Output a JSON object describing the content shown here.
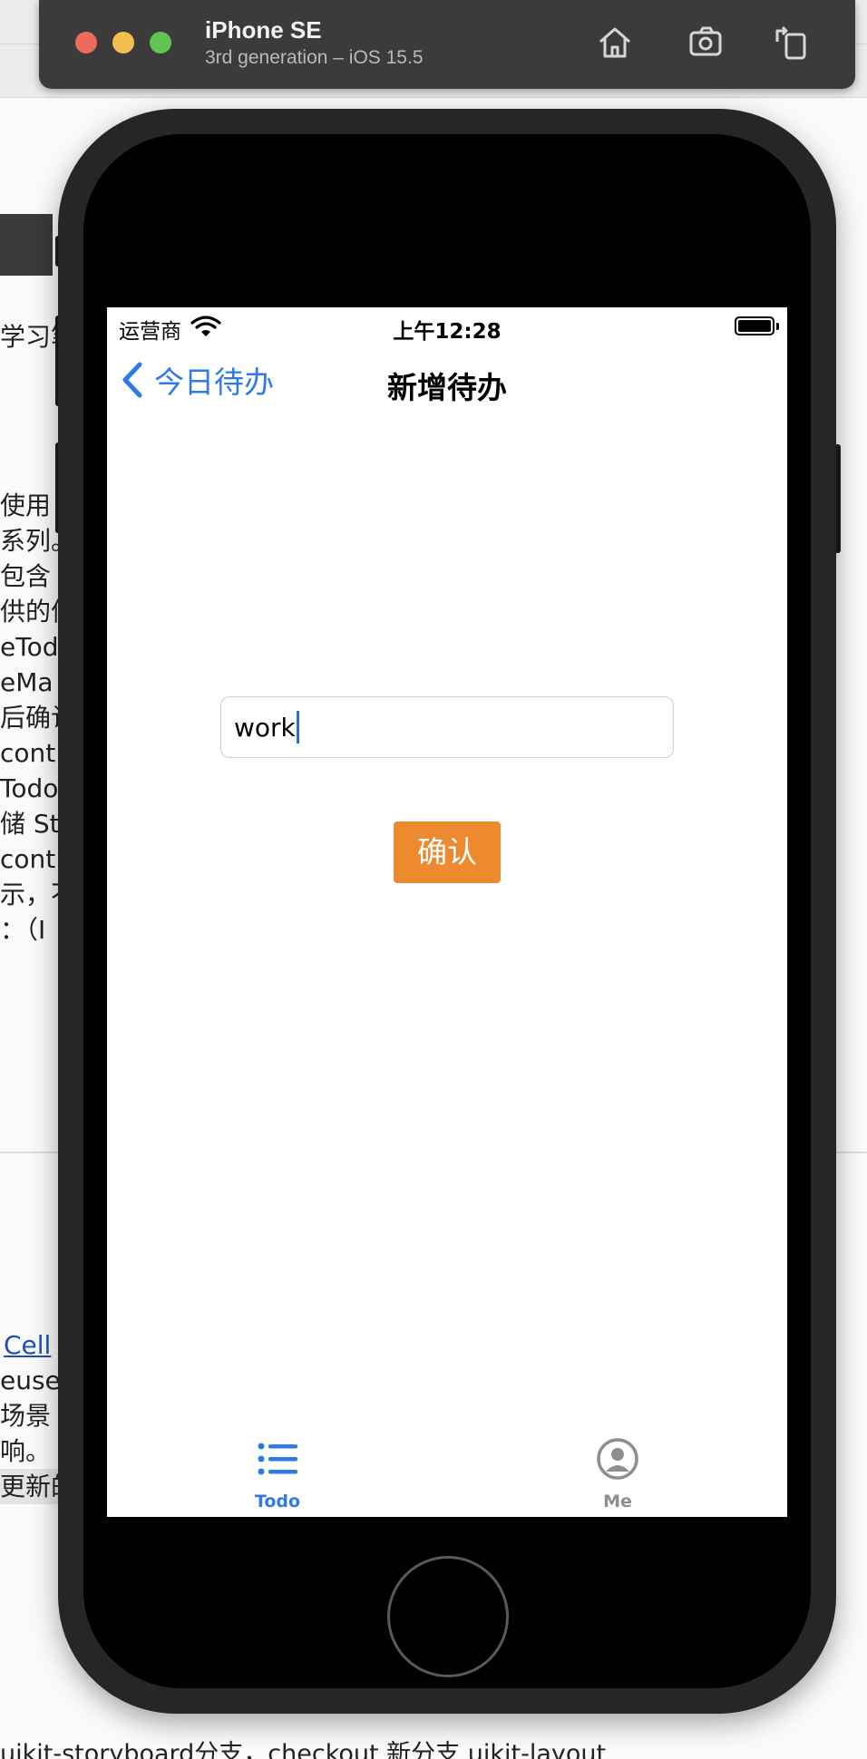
{
  "background_page": {
    "lines": [
      "学习笔",
      "使用",
      "系列。",
      "包含 U",
      "供的信",
      "eTod",
      "eMa",
      "后确认",
      "cont",
      "TodoL",
      "储 St",
      "cont",
      "示，不",
      "：（I"
    ],
    "link_text": "Cell",
    "lower_lines": [
      "euse,",
      "场景",
      "响。",
      "更新的"
    ],
    "bottom_text": "uikit-storyboard分支，checkout 新分支 uikit-layout"
  },
  "simulator": {
    "device_name": "iPhone SE",
    "device_subtitle": "3rd generation – iOS 15.5",
    "buttons": [
      "home-icon",
      "screenshot-icon",
      "rotate-icon"
    ]
  },
  "status_bar": {
    "carrier": "运营商",
    "time": "上午12:28"
  },
  "nav": {
    "back_label": "今日待办",
    "title": "新增待办"
  },
  "form": {
    "input_value": "work",
    "confirm_label": "确认"
  },
  "tab_bar": {
    "tabs": [
      {
        "label": "Todo",
        "icon": "list-icon",
        "selected": true
      },
      {
        "label": "Me",
        "icon": "person-circle-icon",
        "selected": false
      }
    ]
  },
  "colors": {
    "accent_blue": "#2f7ae5",
    "confirm_orange": "#ed8a30",
    "tab_inactive": "#8e8e8e"
  }
}
